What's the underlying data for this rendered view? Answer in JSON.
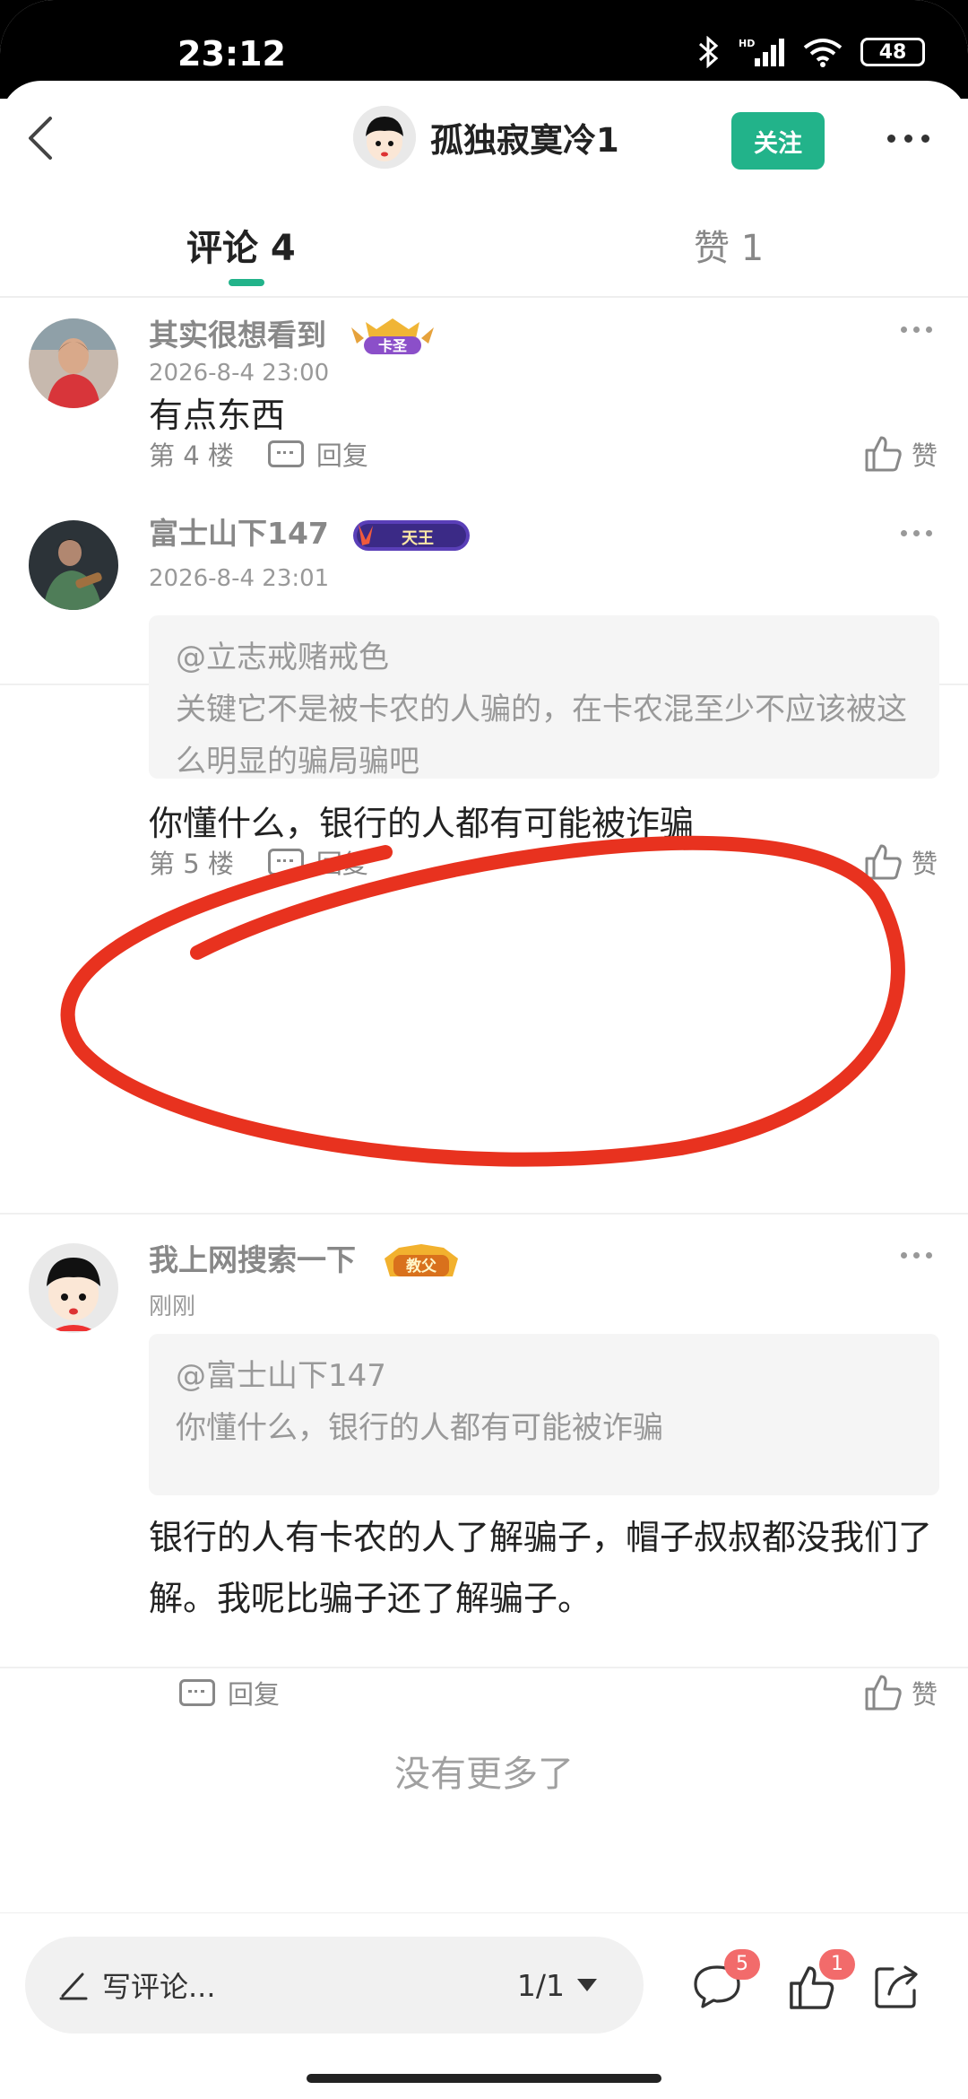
{
  "status_bar": {
    "time": "23:12",
    "battery": "48"
  },
  "header": {
    "title": "孤独寂寞冷1",
    "follow_label": "关注"
  },
  "tabs": [
    {
      "label": "评论 4"
    },
    {
      "label": "赞 1"
    }
  ],
  "comments": [
    {
      "username": "其实很想看到",
      "badge": "卡圣",
      "time": "2026-8-4 23:00",
      "text": "有点东西",
      "floor": "第 4 楼",
      "reply_label": "回复",
      "like_label": "赞"
    },
    {
      "username": "富士山下147",
      "badge": "天王",
      "time": "2026-8-4 23:01",
      "quote_user": "@立志戒赌戒色",
      "quote_text": "关键它不是被卡农的人骗的，在卡农混至少不应该被这么明显的骗局骗吧",
      "text": "你懂什么，银行的人都有可能被诈骗",
      "floor": "第 5 楼",
      "reply_label": "回复",
      "like_label": "赞"
    },
    {
      "username": "我上网搜索一下",
      "badge": "教父",
      "time": "刚刚",
      "quote_user": "@富士山下147",
      "quote_text": "你懂什么，银行的人都有可能被诈骗",
      "text": "银行的人有卡农的人了解骗子，帽子叔叔都没我们了解。我呢比骗子还了解骗子。",
      "reply_label": "回复",
      "like_label": "赞"
    }
  ],
  "no_more_text": "没有更多了",
  "bottom_bar": {
    "write_placeholder": "写评论...",
    "page_indicator": "1/1",
    "comment_count": "5",
    "like_count": "1"
  },
  "colors": {
    "accent": "#22b38a",
    "badge_red": "#f26b6b",
    "annotation_red": "#e8321f"
  }
}
